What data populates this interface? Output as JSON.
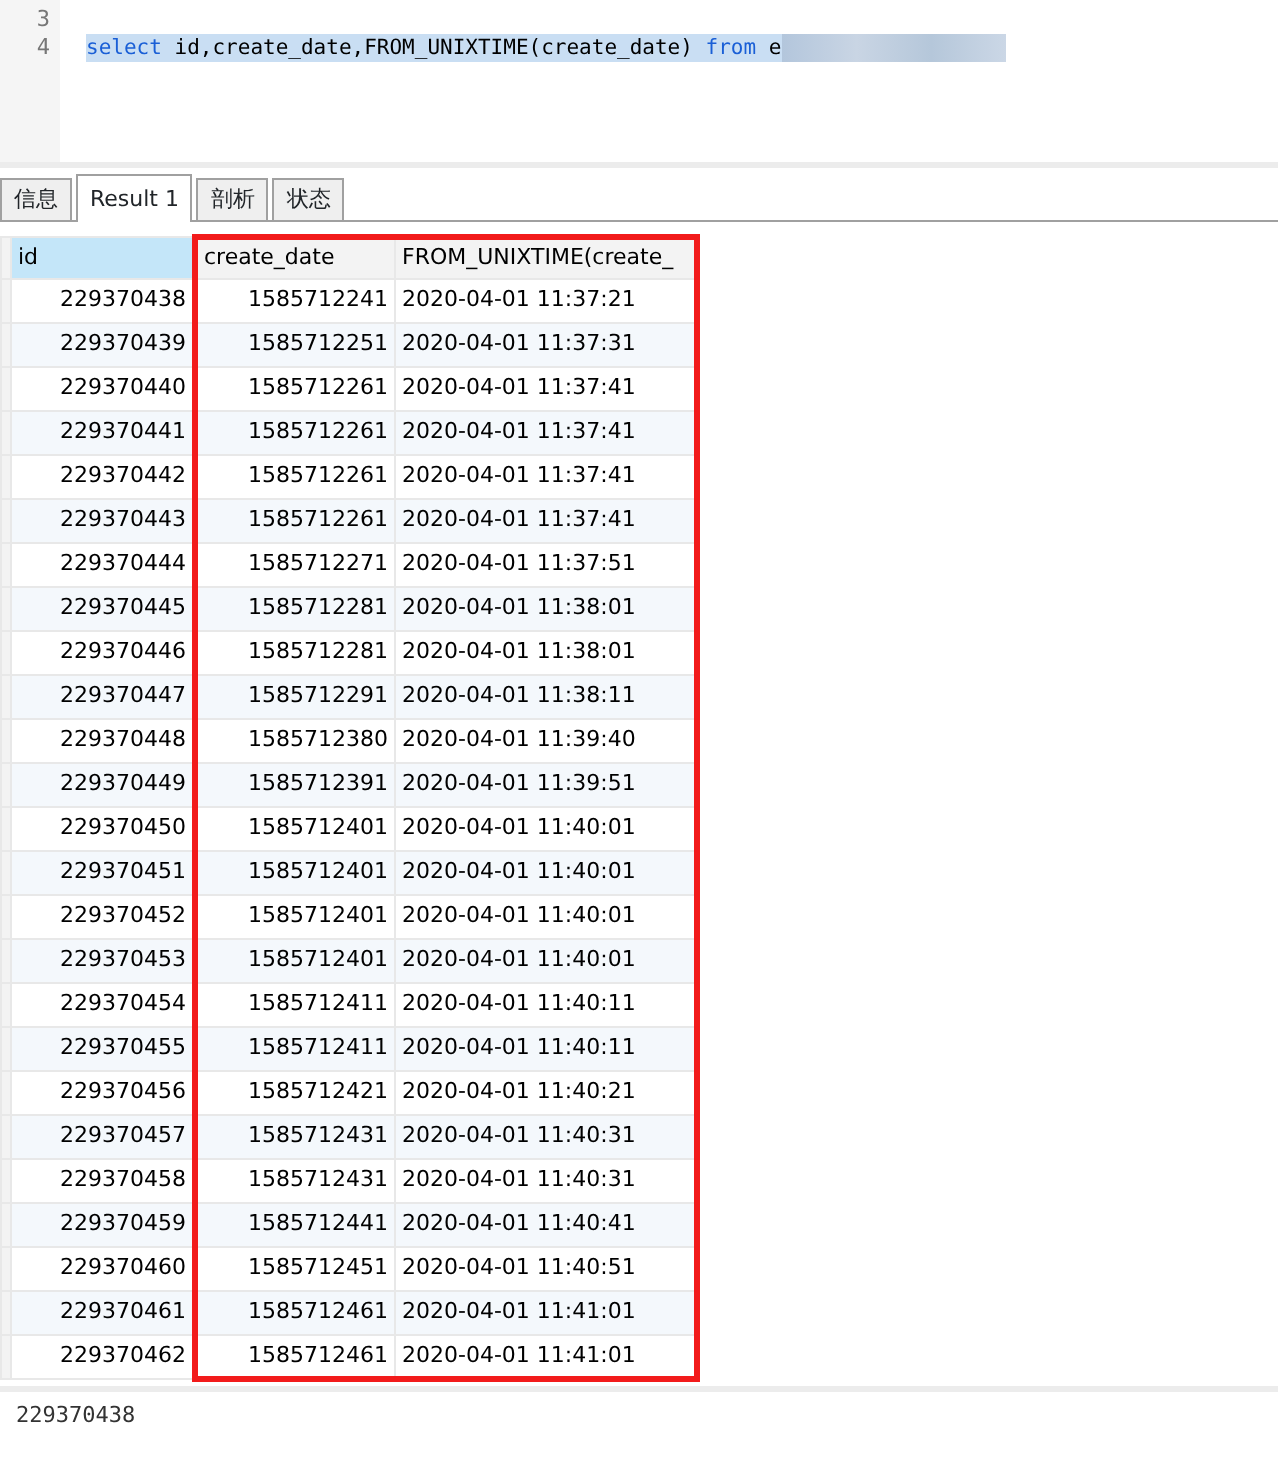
{
  "editor": {
    "lines": [
      {
        "number": "3"
      },
      {
        "number": "4",
        "selected": true,
        "redacted": true,
        "tokens": [
          {
            "kind": "keyword",
            "text": "select"
          },
          {
            "kind": "plain",
            "text": " id,create_date,FROM_UNIXTIME(create_date) "
          },
          {
            "kind": "keyword",
            "text": "from"
          },
          {
            "kind": "plain",
            "text": " e"
          }
        ]
      }
    ]
  },
  "tabs": [
    {
      "label": "信息",
      "selected": false
    },
    {
      "label": "Result 1",
      "selected": true
    },
    {
      "label": "剖析",
      "selected": false
    },
    {
      "label": "状态",
      "selected": false
    }
  ],
  "table": {
    "columns": [
      {
        "label": "id",
        "selected": true,
        "highlighted": false
      },
      {
        "label": "create_date",
        "selected": false,
        "highlighted": true
      },
      {
        "label": "FROM_UNIXTIME(create_",
        "selected": false,
        "highlighted": true
      }
    ],
    "rows": [
      [
        "229370438",
        "1585712241",
        "2020-04-01 11:37:21"
      ],
      [
        "229370439",
        "1585712251",
        "2020-04-01 11:37:31"
      ],
      [
        "229370440",
        "1585712261",
        "2020-04-01 11:37:41"
      ],
      [
        "229370441",
        "1585712261",
        "2020-04-01 11:37:41"
      ],
      [
        "229370442",
        "1585712261",
        "2020-04-01 11:37:41"
      ],
      [
        "229370443",
        "1585712261",
        "2020-04-01 11:37:41"
      ],
      [
        "229370444",
        "1585712271",
        "2020-04-01 11:37:51"
      ],
      [
        "229370445",
        "1585712281",
        "2020-04-01 11:38:01"
      ],
      [
        "229370446",
        "1585712281",
        "2020-04-01 11:38:01"
      ],
      [
        "229370447",
        "1585712291",
        "2020-04-01 11:38:11"
      ],
      [
        "229370448",
        "1585712380",
        "2020-04-01 11:39:40"
      ],
      [
        "229370449",
        "1585712391",
        "2020-04-01 11:39:51"
      ],
      [
        "229370450",
        "1585712401",
        "2020-04-01 11:40:01"
      ],
      [
        "229370451",
        "1585712401",
        "2020-04-01 11:40:01"
      ],
      [
        "229370452",
        "1585712401",
        "2020-04-01 11:40:01"
      ],
      [
        "229370453",
        "1585712401",
        "2020-04-01 11:40:01"
      ],
      [
        "229370454",
        "1585712411",
        "2020-04-01 11:40:11"
      ],
      [
        "229370455",
        "1585712411",
        "2020-04-01 11:40:11"
      ],
      [
        "229370456",
        "1585712421",
        "2020-04-01 11:40:21"
      ],
      [
        "229370457",
        "1585712431",
        "2020-04-01 11:40:31"
      ],
      [
        "229370458",
        "1585712431",
        "2020-04-01 11:40:31"
      ],
      [
        "229370459",
        "1585712441",
        "2020-04-01 11:40:41"
      ],
      [
        "229370460",
        "1585712451",
        "2020-04-01 11:40:51"
      ],
      [
        "229370461",
        "1585712461",
        "2020-04-01 11:41:01"
      ],
      [
        "229370462",
        "1585712461",
        "2020-04-01 11:41:01"
      ]
    ]
  },
  "status_bar": {
    "text": "229370438"
  }
}
